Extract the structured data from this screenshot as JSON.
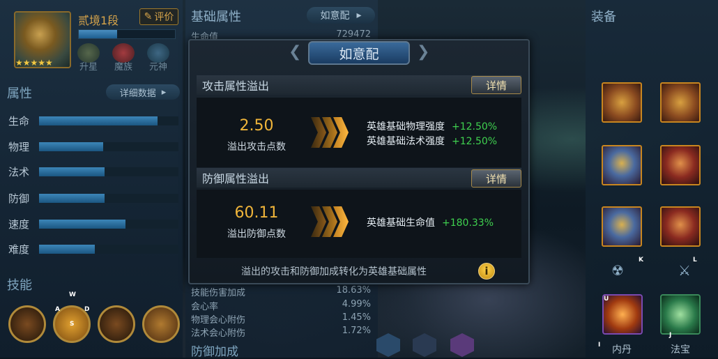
{
  "hero": {
    "rank": "贰境1段",
    "rate_label": "评价",
    "stars": "★★★★★",
    "xp_fraction": 0.4,
    "tags": [
      "升星",
      "魔族",
      "元神"
    ]
  },
  "attributes": {
    "title": "属性",
    "detail_label": "详细数据",
    "stats": [
      {
        "label": "生命",
        "fraction": 0.85
      },
      {
        "label": "物理",
        "fraction": 0.46
      },
      {
        "label": "法术",
        "fraction": 0.47
      },
      {
        "label": "防御",
        "fraction": 0.47
      },
      {
        "label": "速度",
        "fraction": 0.62
      },
      {
        "label": "难度",
        "fraction": 0.4
      }
    ]
  },
  "skills": {
    "title": "技能",
    "key_hints": {
      "w": "W",
      "a": "A",
      "s": "S",
      "d": "D"
    }
  },
  "base_panel": {
    "title": "基础属性",
    "ryp_label": "如意配",
    "hp_label": "生命值",
    "hp_value": "729472",
    "rows": [
      {
        "label": "技能伤害加成",
        "value": "18.63%"
      },
      {
        "label": "会心率",
        "value": "4.99%"
      },
      {
        "label": "物理会心附伤",
        "value": "1.45%"
      },
      {
        "label": "法术会心附伤",
        "value": "1.72%"
      }
    ],
    "defense_title": "防御加成"
  },
  "equipment": {
    "title": "装备",
    "key_hints": {
      "k": "K",
      "l": "L",
      "u": "U",
      "i": "I",
      "j": "J"
    },
    "bottom": [
      {
        "label": "内丹"
      },
      {
        "label": "法宝"
      }
    ]
  },
  "modal": {
    "title": "如意配",
    "attack": {
      "header": "攻击属性溢出",
      "detail_label": "详情",
      "value": "2.50",
      "value_label": "溢出攻击点数",
      "bonuses": [
        {
          "label": "英雄基础物理强度",
          "value": "+12.50%"
        },
        {
          "label": "英雄基础法术强度",
          "value": "+12.50%"
        }
      ]
    },
    "defense": {
      "header": "防御属性溢出",
      "detail_label": "详情",
      "value": "60.11",
      "value_label": "溢出防御点数",
      "bonuses": [
        {
          "label": "英雄基础生命值",
          "value": "+180.33%"
        }
      ]
    },
    "footer": "溢出的攻击和防御加成转化为英雄基础属性",
    "info_glyph": "i"
  },
  "colors": {
    "accent_gold": "#f0b53a",
    "bonus_green": "#3fd14f",
    "bar_blue": "#3c86b8"
  }
}
